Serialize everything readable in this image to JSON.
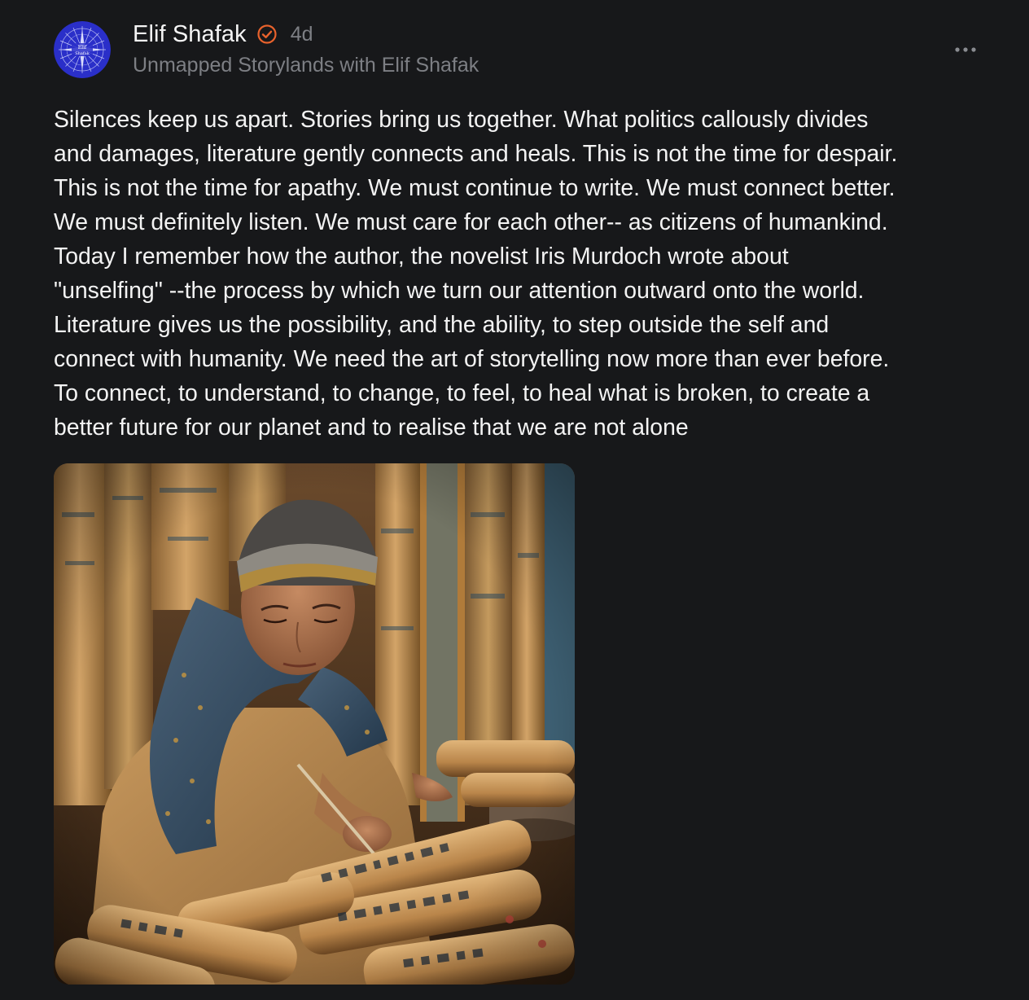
{
  "post": {
    "author": {
      "name": "Elif Shafak",
      "avatar_text_line1": "Elif",
      "avatar_text_line2": "Shafak",
      "verified": true,
      "verified_icon": "verified-check-icon",
      "verified_color": "#e8622c"
    },
    "timestamp": "4d",
    "publication": "Unmapped Storylands with Elif Shafak",
    "menu_icon": "more-horizontal-icon",
    "body": "Silences keep us apart. Stories bring us together. What politics callously divides\nand damages, literature gently connects and heals. This is not the time for despair.\nThis is not the time for apathy. We must continue to write. We must connect better.\nWe must definitely listen. We must care for each other-- as citizens of humankind.\nToday I remember how the author, the novelist Iris Murdoch wrote about\n\"unselfing\" --the process by which we turn our attention outward onto the world.\nLiterature gives us the possibility, and the ability, to step outside the self and\nconnect with humanity. We need the art of storytelling now more than ever before.\nTo connect, to understand, to change, to feel, to heal what is broken, to create a\nbetter future for our planet and to realise that we are not alone"
  },
  "colors": {
    "background": "#17181a",
    "text_primary": "#f3f3f3",
    "text_secondary": "#7d7f84",
    "avatar_bg": "#2a2fc9",
    "accent": "#e8622c"
  }
}
